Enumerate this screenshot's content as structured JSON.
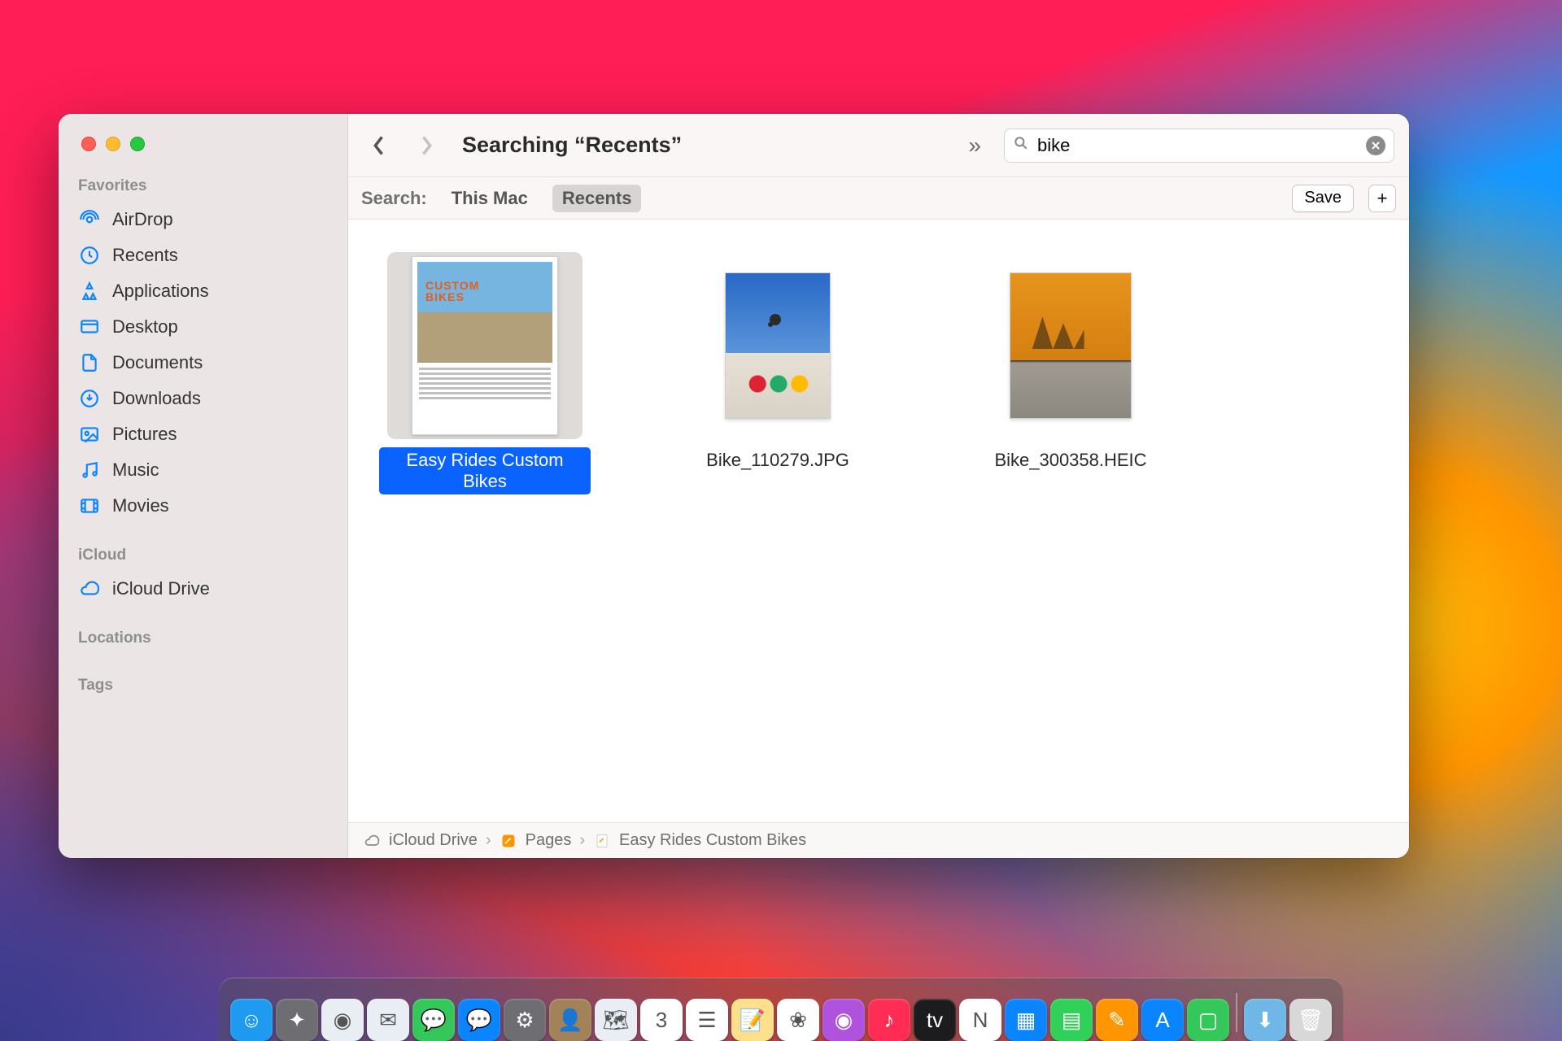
{
  "window": {
    "title": "Searching “Recents”"
  },
  "sidebar": {
    "sections": {
      "favorites": "Favorites",
      "icloud": "iCloud",
      "locations": "Locations",
      "tags": "Tags"
    },
    "items": {
      "airdrop": "AirDrop",
      "recents": "Recents",
      "applications": "Applications",
      "desktop": "Desktop",
      "documents": "Documents",
      "downloads": "Downloads",
      "pictures": "Pictures",
      "music": "Music",
      "movies": "Movies",
      "icloud_drive": "iCloud Drive"
    }
  },
  "search": {
    "value": "bike"
  },
  "scope": {
    "label": "Search:",
    "this_mac": "This Mac",
    "recents": "Recents",
    "save": "Save"
  },
  "files": [
    {
      "name": "Easy Rides Custom Bikes",
      "selected": true,
      "kind": "doc"
    },
    {
      "name": "Bike_110279.JPG",
      "selected": false,
      "kind": "img-sky"
    },
    {
      "name": "Bike_300358.HEIC",
      "selected": false,
      "kind": "img-sun"
    }
  ],
  "path": {
    "icloud": "iCloud Drive",
    "pages": "Pages",
    "file": "Easy Rides Custom Bikes"
  },
  "dock": [
    {
      "name": "finder",
      "color": "#1e9bf0",
      "glyph": "☺"
    },
    {
      "name": "launchpad",
      "color": "#6d6d72",
      "glyph": "✦"
    },
    {
      "name": "safari",
      "color": "#e8eef3",
      "glyph": "◉"
    },
    {
      "name": "mail",
      "color": "#e8eef3",
      "glyph": "✉"
    },
    {
      "name": "messages",
      "color": "#34c759",
      "glyph": "💬"
    },
    {
      "name": "chat-blue",
      "color": "#0a84ff",
      "glyph": "💬"
    },
    {
      "name": "preferences",
      "color": "#6d6d72",
      "glyph": "⚙"
    },
    {
      "name": "contacts",
      "color": "#a28258",
      "glyph": "👤"
    },
    {
      "name": "maps",
      "color": "#e8eef3",
      "glyph": "🗺"
    },
    {
      "name": "calendar",
      "color": "#ffffff",
      "glyph": "3"
    },
    {
      "name": "reminders",
      "color": "#ffffff",
      "glyph": "☰"
    },
    {
      "name": "notes",
      "color": "#ffe08a",
      "glyph": "📝"
    },
    {
      "name": "photos",
      "color": "#ffffff",
      "glyph": "❀"
    },
    {
      "name": "podcasts",
      "color": "#af52de",
      "glyph": "◉"
    },
    {
      "name": "music",
      "color": "#ff2d55",
      "glyph": "♪"
    },
    {
      "name": "tv",
      "color": "#1c1c1e",
      "glyph": "tv"
    },
    {
      "name": "news",
      "color": "#ffffff",
      "glyph": "N"
    },
    {
      "name": "keynote",
      "color": "#0a84ff",
      "glyph": "▦"
    },
    {
      "name": "numbers",
      "color": "#30d158",
      "glyph": "▤"
    },
    {
      "name": "pages",
      "color": "#ff9500",
      "glyph": "✎"
    },
    {
      "name": "appstore",
      "color": "#0a84ff",
      "glyph": "A"
    },
    {
      "name": "facetime",
      "color": "#34c759",
      "glyph": "▢"
    }
  ],
  "dock_right": [
    {
      "name": "downloads-stack",
      "color": "#6fb7e6",
      "glyph": "⬇"
    },
    {
      "name": "trash",
      "color": "#d8d8d8",
      "glyph": "🗑"
    }
  ]
}
